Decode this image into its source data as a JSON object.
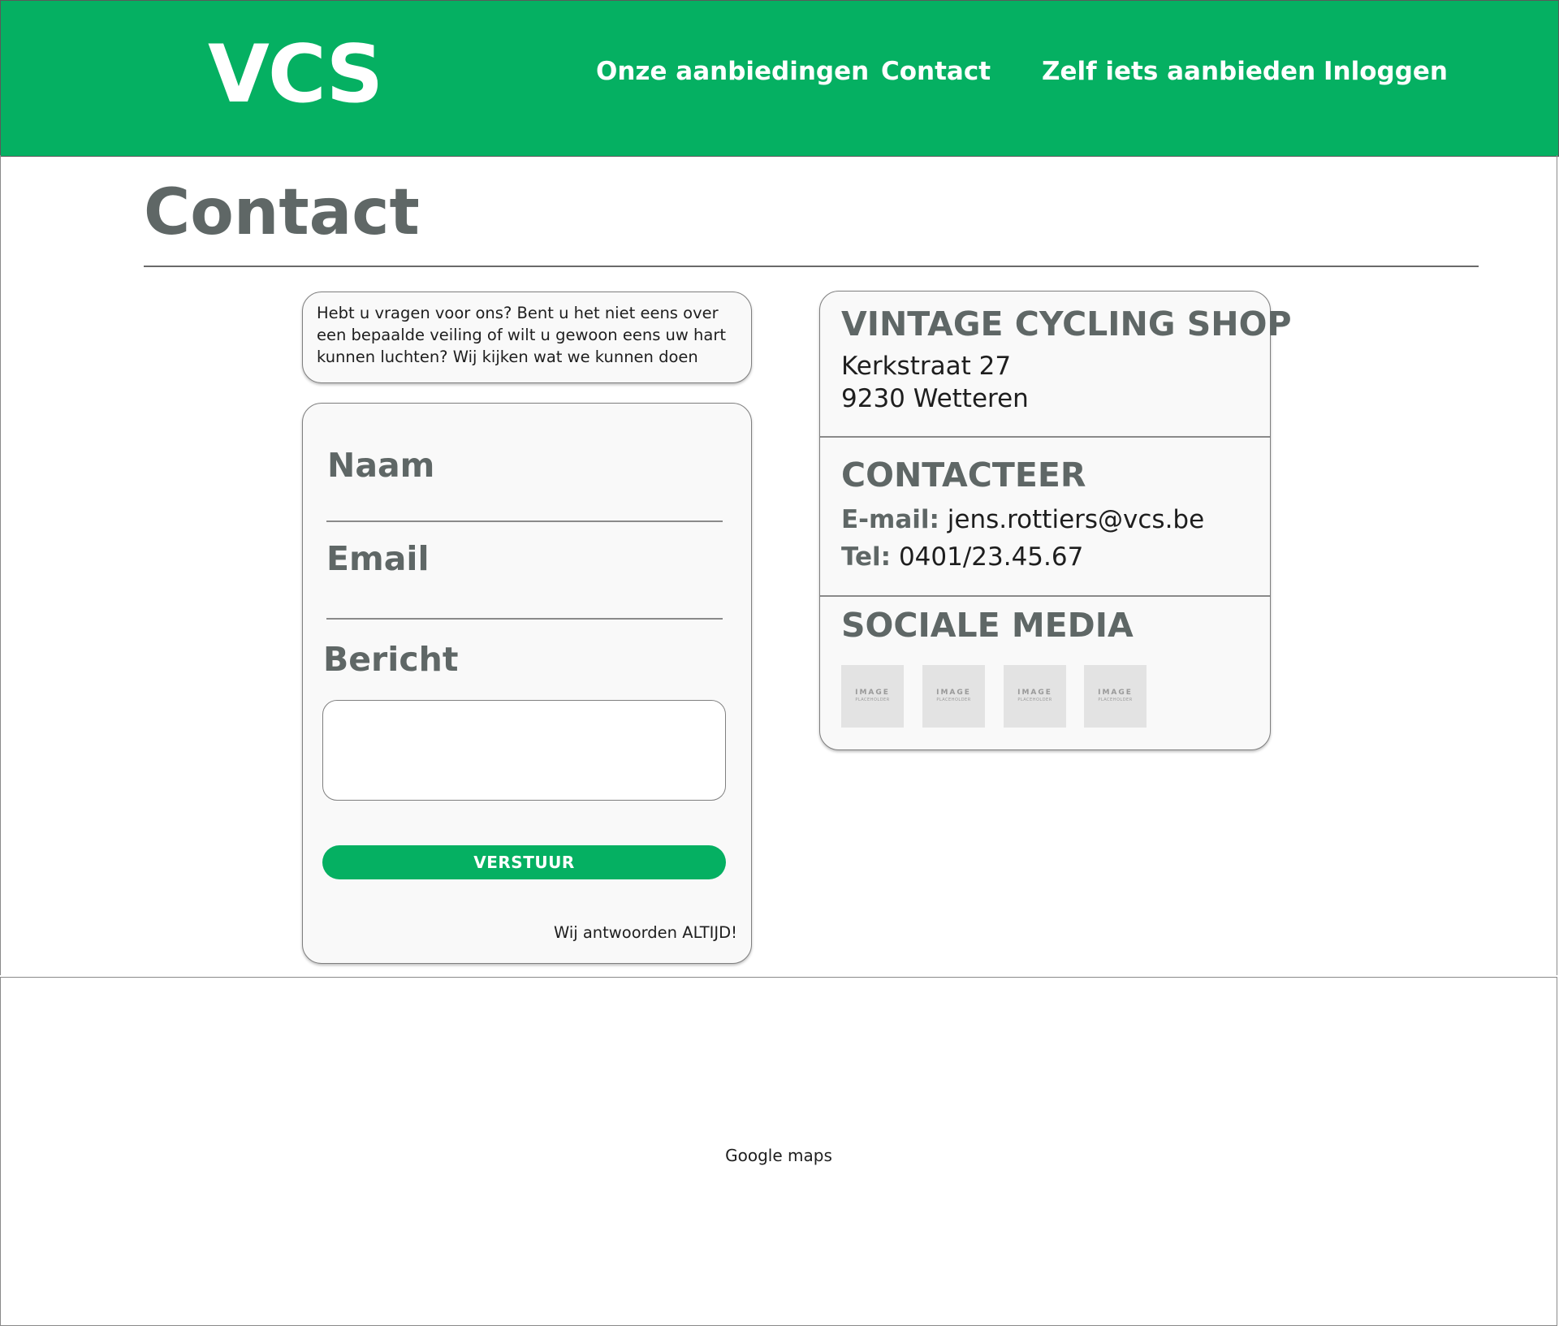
{
  "header": {
    "logo": "VCS",
    "nav": [
      "Onze aanbiedingen",
      "Contact",
      "Zelf iets aanbieden",
      "Inloggen"
    ],
    "background_color": "#05b062"
  },
  "page": {
    "title": "Contact"
  },
  "intro": {
    "text": "Hebt u vragen voor ons? Bent u het niet eens over een bepaalde veiling of wilt u gewoon eens uw hart kunnen luchten? Wij kijken wat we kunnen doen"
  },
  "form": {
    "name_label": "Naam",
    "email_label": "Email",
    "message_label": "Bericht",
    "message_value": "",
    "submit_label": "VERSTUUR",
    "footer_note": "Wij antwoorden ALTIJD!"
  },
  "info": {
    "shop_name": "VINTAGE CYCLING SHOP",
    "address_line1": "Kerkstraat 27",
    "address_line2": "9230 Wetteren",
    "contact_heading": "CONTACTEER",
    "email_key": "E-mail:",
    "email_value": "jens.rottiers@vcs.be",
    "phone_key": "Tel:",
    "phone_value": "0401/23.45.67",
    "social_heading": "SOCIALE MEDIA",
    "social_icons": [
      {
        "top": "IMAGE",
        "sub": "PLACEHOLDER"
      },
      {
        "top": "IMAGE",
        "sub": "PLACEHOLDER"
      },
      {
        "top": "IMAGE",
        "sub": "PLACEHOLDER"
      },
      {
        "top": "IMAGE",
        "sub": "PLACEHOLDER"
      }
    ]
  },
  "map": {
    "label": "Google maps"
  },
  "colors": {
    "accent": "#05b062",
    "heading_gray": "#5f6766",
    "card_bg": "#f9f9f9"
  }
}
